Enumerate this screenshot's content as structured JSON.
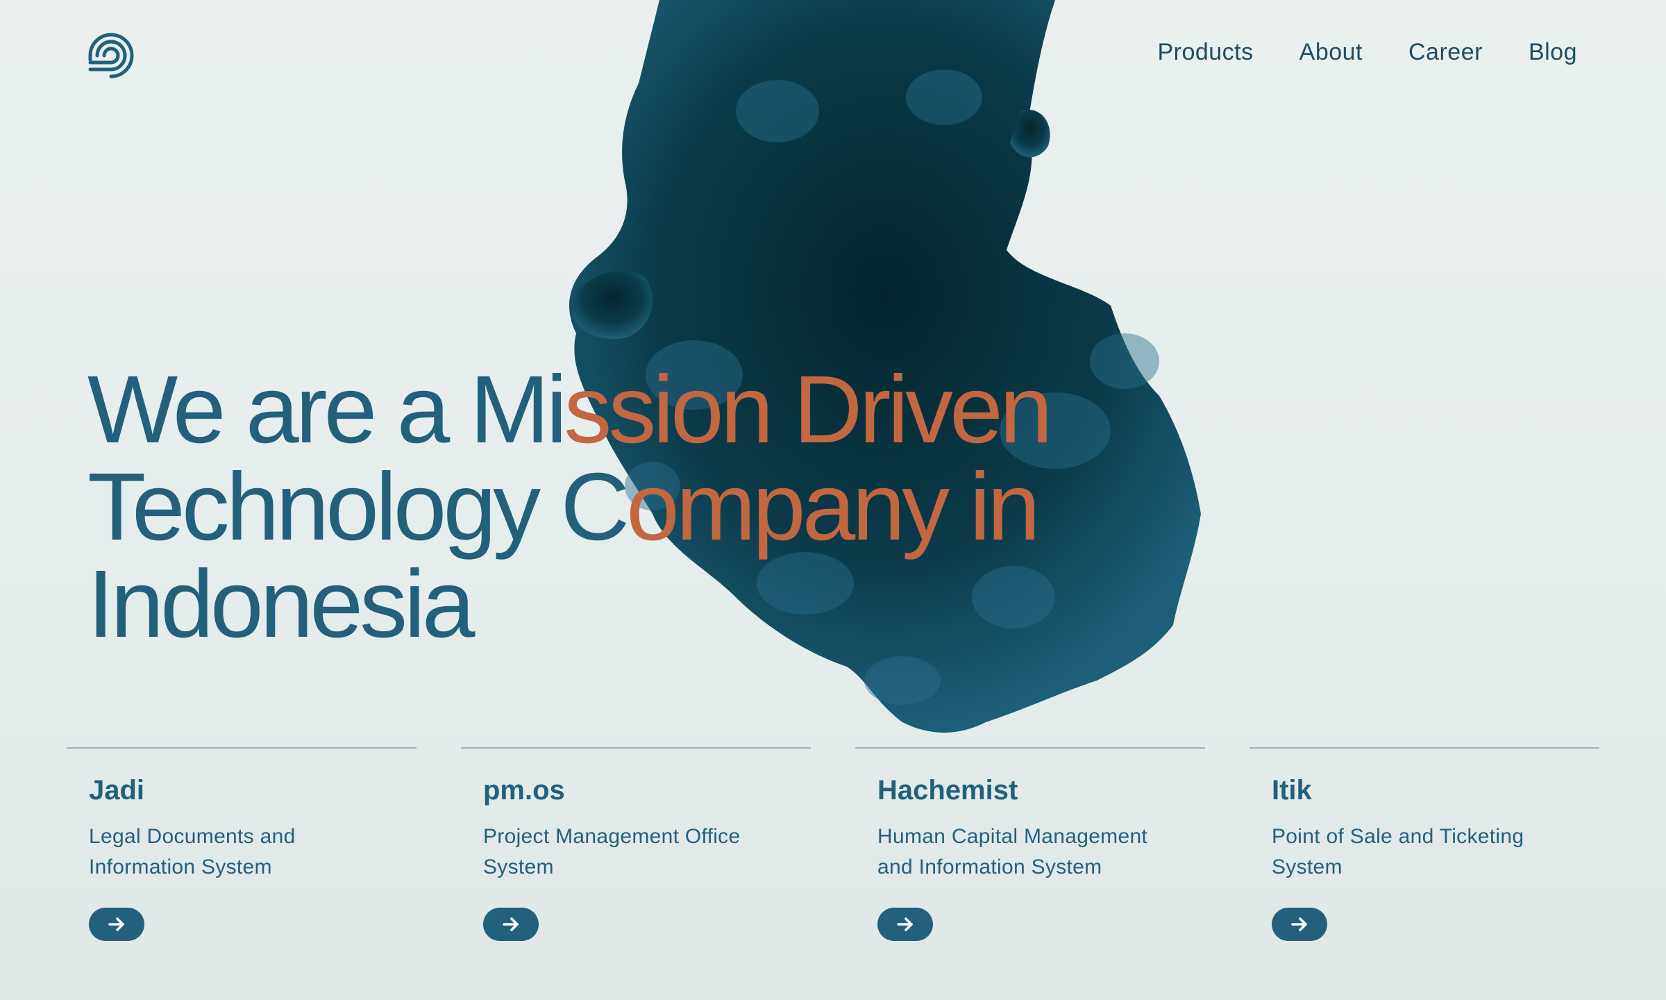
{
  "brand": {
    "logo_icon": "concentric-swirl-icon",
    "color": "#22607c"
  },
  "nav": {
    "items": [
      {
        "label": "Products"
      },
      {
        "label": "About"
      },
      {
        "label": "Career"
      },
      {
        "label": "Blog"
      }
    ]
  },
  "hero": {
    "line1_blue": "We are a Mi",
    "line1_orange": "ssion Driven",
    "line2_blue": "Technology C",
    "line2_orange": "ompany in",
    "line3_blue": "Indonesia",
    "accent_color": "#c2673f",
    "primary_color": "#22607c"
  },
  "products": [
    {
      "name": "Jadi",
      "description": "Legal Documents and Information System",
      "action_icon": "arrow-right-icon"
    },
    {
      "name": "pm.os",
      "description": "Project Management Office System",
      "action_icon": "arrow-right-icon"
    },
    {
      "name": "Hachemist",
      "description": "Human Capital Management and Information System",
      "action_icon": "arrow-right-icon"
    },
    {
      "name": "Itik",
      "description": "Point of Sale and Ticketing System",
      "action_icon": "arrow-right-icon"
    }
  ]
}
